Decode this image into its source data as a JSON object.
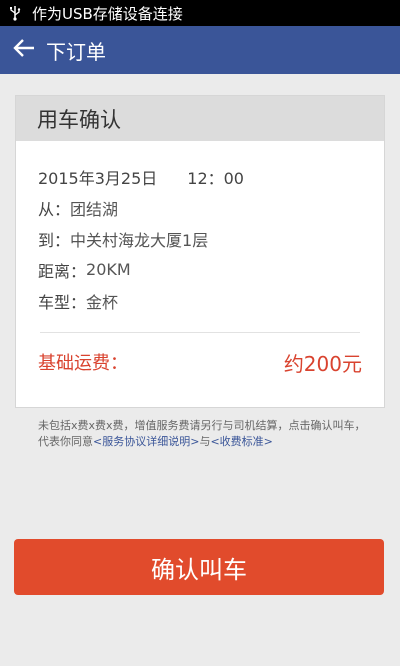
{
  "status_bar": {
    "usb_icon": "usb-icon",
    "message": "作为USB存储设备连接"
  },
  "header": {
    "back_icon": "arrow-left-icon",
    "title": "下订单"
  },
  "card": {
    "title": "用车确认",
    "date": "2015年3月25日",
    "time": "12：00",
    "from_label": "从：",
    "from_value": "团结湖",
    "to_label": "到：",
    "to_value": "中关村海龙大厦1层",
    "distance_label": "距离：",
    "distance_value": "20KM",
    "car_label": "车型：",
    "car_value": "金杯",
    "fee_label": "基础运费：",
    "fee_value": "约200元"
  },
  "notice": {
    "line1": "未包括x费x费x费，增值服务费请另行与司机结算，点击确认叫车，",
    "line2_prefix": "代表你同意",
    "link_agreement": "<服务协议详细说明>",
    "conj": "与",
    "link_fees": "<收费标准>"
  },
  "actions": {
    "confirm_label": "确认叫车"
  },
  "colors": {
    "header_bg": "#3a5598",
    "accent_red": "#e14b2c",
    "fee_red": "#d9432f"
  }
}
